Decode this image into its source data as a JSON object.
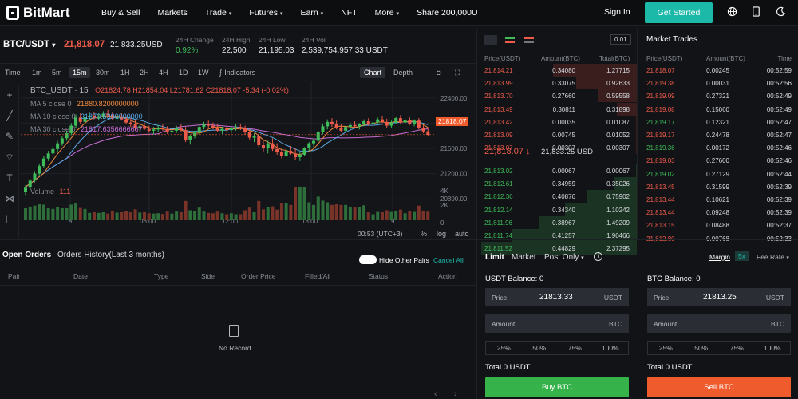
{
  "nav": {
    "brand": "BitMart",
    "menu": [
      "Buy & Sell",
      "Markets",
      "Trade",
      "Futures",
      "Earn",
      "NFT",
      "More",
      "Share 200,000U"
    ],
    "menu_caret": [
      false,
      false,
      true,
      true,
      true,
      false,
      true,
      false
    ],
    "sign_in": "Sign In",
    "get_started": "Get Started",
    "icons": [
      "globe-icon",
      "download-icon",
      "moon-icon"
    ]
  },
  "ticker": {
    "pair": "BTC/USDT",
    "last_price": "21,818.07",
    "usd_price": "21,833.25USD",
    "stats": [
      {
        "label": "24H Change",
        "value": "0.92%",
        "color": "#3fbd5a"
      },
      {
        "label": "24H High",
        "value": "22,500",
        "color": "#e8eaed"
      },
      {
        "label": "24H Low",
        "value": "21,195.03",
        "color": "#e8eaed"
      },
      {
        "label": "24H Vol",
        "value": "2,539,754,957.33 USDT",
        "color": "#e8eaed"
      }
    ]
  },
  "chart": {
    "timeframes": [
      "Time",
      "1m",
      "5m",
      "15m",
      "30m",
      "1H",
      "2H",
      "4H",
      "1D",
      "1W"
    ],
    "selected_timeframe": "15m",
    "indicators": "Indicators",
    "views": [
      "Chart",
      "Depth"
    ],
    "symbol_line": "BTC_USDT · 15",
    "ohlc": {
      "o": "21824.78",
      "h": "21854.04",
      "l": "21781.62",
      "c": "21818.07",
      "chg": "-5.34 (-0.02%)"
    },
    "ma": [
      {
        "label": "MA 5 close 0",
        "value": "21880.8200000000",
        "color": "#ef8a3c"
      },
      {
        "label": "MA 10 close 0",
        "value": "21870.5390000000",
        "color": "#5aa9e6"
      },
      {
        "label": "MA 30 close 0",
        "value": "21817.6356666667",
        "color": "#c86dd7"
      }
    ],
    "volume_label": "Volume",
    "volume_value": "111",
    "price_ticks": [
      "22400.00",
      "22000.00",
      "21600.00",
      "21200.00",
      "20800.00"
    ],
    "current_price_tag": "21818.07",
    "volume_ticks": [
      "4K",
      "2K",
      "0"
    ],
    "time_ticks": [
      "8",
      "06:00",
      "12:00",
      "18:00",
      "9"
    ],
    "clock": "00:53 (UTC+3)",
    "bottom_opts": [
      "%",
      "log",
      "auto"
    ],
    "colors": {
      "up": "#3fbd5a",
      "down": "#ef5b4b"
    }
  },
  "chart_data": {
    "type": "candlestick",
    "ylim": [
      20600,
      22600
    ],
    "candles": [
      [
        20910,
        21020,
        20860,
        20990
      ],
      [
        20990,
        21120,
        20950,
        21090
      ],
      [
        21090,
        21240,
        21060,
        21200
      ],
      [
        21200,
        21360,
        21160,
        21320
      ],
      [
        21320,
        21480,
        21290,
        21440
      ],
      [
        21440,
        21560,
        21400,
        21520
      ],
      [
        21520,
        21640,
        21480,
        21590
      ],
      [
        21590,
        21720,
        21550,
        21680
      ],
      [
        21680,
        21800,
        21640,
        21760
      ],
      [
        21760,
        21880,
        21720,
        21840
      ],
      [
        21840,
        22000,
        21810,
        21960
      ],
      [
        21960,
        22140,
        21920,
        22090
      ],
      [
        22090,
        22170,
        21980,
        22020
      ],
      [
        22020,
        22130,
        21990,
        22100
      ],
      [
        22100,
        22180,
        22040,
        22120
      ],
      [
        22120,
        22180,
        22060,
        22080
      ],
      [
        22080,
        22160,
        22040,
        22110
      ],
      [
        22110,
        22190,
        22070,
        22150
      ],
      [
        22150,
        22210,
        22090,
        22130
      ],
      [
        22130,
        22180,
        22050,
        22070
      ],
      [
        22070,
        22140,
        22010,
        22100
      ],
      [
        22100,
        22160,
        22040,
        22060
      ],
      [
        22060,
        22110,
        21980,
        22010
      ],
      [
        22010,
        22080,
        21940,
        21980
      ],
      [
        21980,
        22050,
        21880,
        21920
      ],
      [
        21920,
        21990,
        21860,
        21950
      ],
      [
        21950,
        22010,
        21890,
        21910
      ],
      [
        21910,
        21960,
        21850,
        21880
      ],
      [
        21880,
        21940,
        21820,
        21900
      ],
      [
        21900,
        21970,
        21860,
        21930
      ],
      [
        21930,
        21990,
        21880,
        21910
      ],
      [
        21910,
        21950,
        21830,
        21860
      ],
      [
        21860,
        21920,
        21800,
        21880
      ],
      [
        21880,
        21960,
        21840,
        21930
      ],
      [
        21930,
        21980,
        21860,
        21890
      ],
      [
        21890,
        21940,
        21700,
        21740
      ],
      [
        21740,
        21820,
        21660,
        21790
      ],
      [
        21790,
        21880,
        21760,
        21850
      ],
      [
        21850,
        21980,
        21820,
        21940
      ],
      [
        21940,
        22020,
        21900,
        21990
      ],
      [
        21990,
        22040,
        21920,
        21960
      ],
      [
        21960,
        22010,
        21900,
        21930
      ],
      [
        21930,
        21980,
        21860,
        21880
      ],
      [
        21880,
        21940,
        21830,
        21910
      ],
      [
        21910,
        21960,
        21860,
        21890
      ],
      [
        21890,
        21950,
        21840,
        21920
      ],
      [
        21920,
        21980,
        21880,
        21940
      ],
      [
        21940,
        21990,
        21890,
        21920
      ],
      [
        21920,
        21960,
        21820,
        21860
      ],
      [
        21860,
        21900,
        21740,
        21770
      ],
      [
        21770,
        21840,
        21700,
        21800
      ],
      [
        21800,
        21860,
        21620,
        21650
      ],
      [
        21650,
        21740,
        21550,
        21600
      ],
      [
        21600,
        21720,
        21520,
        21680
      ],
      [
        21680,
        21760,
        21560,
        21590
      ],
      [
        21590,
        21680,
        21500,
        21540
      ],
      [
        21540,
        21600,
        21440,
        21480
      ],
      [
        21480,
        21580,
        21460,
        21560
      ],
      [
        21560,
        21640,
        21500,
        21520
      ],
      [
        21520,
        21600,
        21420,
        21460
      ],
      [
        21460,
        21540,
        21400,
        21500
      ],
      [
        21500,
        21620,
        21480,
        21600
      ],
      [
        21600,
        21700,
        21560,
        21680
      ],
      [
        21680,
        21760,
        21620,
        21720
      ],
      [
        21720,
        21880,
        21690,
        21860
      ],
      [
        21860,
        21990,
        21820,
        21950
      ],
      [
        21950,
        22060,
        21900,
        22020
      ],
      [
        22020,
        22080,
        21940,
        21980
      ],
      [
        21980,
        22040,
        21900,
        21930
      ],
      [
        21930,
        21980,
        21860,
        21880
      ],
      [
        21880,
        21960,
        21860,
        21940
      ],
      [
        21940,
        22010,
        21900,
        21970
      ],
      [
        21970,
        22030,
        21920,
        21950
      ],
      [
        21950,
        22000,
        21900,
        21980
      ],
      [
        21980,
        22060,
        21950,
        22030
      ],
      [
        22030,
        22080,
        21960,
        21990
      ],
      [
        21990,
        22040,
        21940,
        22010
      ],
      [
        22010,
        22090,
        21980,
        22060
      ],
      [
        22060,
        22120,
        22000,
        22020
      ],
      [
        22020,
        22070,
        21930,
        21960
      ],
      [
        21960,
        22040,
        21930,
        22010
      ],
      [
        22010,
        22100,
        21990,
        22080
      ],
      [
        22080,
        22130,
        21990,
        22010
      ],
      [
        22010,
        22070,
        21980,
        22050
      ],
      [
        22050,
        22090,
        21970,
        21990
      ],
      [
        21990,
        22060,
        21950,
        22040
      ],
      [
        22040,
        22080,
        21900,
        21930
      ],
      [
        21930,
        21970,
        21840,
        21870
      ],
      [
        21870,
        21910,
        21790,
        21820
      ]
    ]
  },
  "orderbook": {
    "precision": "0.01",
    "headers": [
      "Price(USDT)",
      "Amount(BTC)",
      "Total(BTC)"
    ],
    "asks": [
      [
        "21,814.21",
        "0.34080",
        "1.27715"
      ],
      [
        "21,813.99",
        "0.33075",
        "0.92633"
      ],
      [
        "21,813.70",
        "0.27660",
        "0.59558"
      ],
      [
        "21,813.49",
        "0.30811",
        "0.31898"
      ],
      [
        "21,813.42",
        "0.00035",
        "0.01087"
      ],
      [
        "21,813.09",
        "0.00745",
        "0.01052"
      ],
      [
        "21,813.07",
        "0.00307",
        "0.00307"
      ]
    ],
    "mid_price": "21,818.07",
    "mid_usd": "21,833.25 USD",
    "bids": [
      [
        "21,813.02",
        "0.00067",
        "0.00067"
      ],
      [
        "21,812.61",
        "0.34959",
        "0.35026"
      ],
      [
        "21,812.36",
        "0.40876",
        "0.75902"
      ],
      [
        "21,812.14",
        "0.34340",
        "1.10242"
      ],
      [
        "21,811.96",
        "0.38967",
        "1.49209"
      ],
      [
        "21,811.74",
        "0.41257",
        "1.90466"
      ],
      [
        "21,811.52",
        "0.44829",
        "2.37295"
      ]
    ],
    "ask_depth": [
      0.54,
      0.39,
      0.25,
      0.13,
      0.005,
      0.005,
      0.001
    ],
    "bid_depth": [
      0.001,
      0.15,
      0.32,
      0.46,
      0.63,
      0.8,
      1.0
    ]
  },
  "market_trades": {
    "title": "Market Trades",
    "headers": [
      "Price(USDT)",
      "Amount(BTC)",
      "Time"
    ],
    "rows": [
      [
        "21,818.07",
        "0.00245",
        "00:52:59",
        "down"
      ],
      [
        "21,819.38",
        "0.00031",
        "00:52:56",
        "down"
      ],
      [
        "21,819.09",
        "0.27321",
        "00:52:49",
        "down"
      ],
      [
        "21,819.08",
        "0.15060",
        "00:52:49",
        "down"
      ],
      [
        "21,819.17",
        "0.12321",
        "00:52:47",
        "up"
      ],
      [
        "21,819.17",
        "0.24478",
        "00:52:47",
        "down"
      ],
      [
        "21,819.36",
        "0.00172",
        "00:52:46",
        "up"
      ],
      [
        "21,819.03",
        "0.27600",
        "00:52:46",
        "down"
      ],
      [
        "21,819.02",
        "0.27129",
        "00:52:44",
        "up"
      ],
      [
        "21,813.45",
        "0.31599",
        "00:52:39",
        "down"
      ],
      [
        "21,813.44",
        "0.10621",
        "00:52:39",
        "down"
      ],
      [
        "21,813.44",
        "0.09248",
        "00:52:39",
        "down"
      ],
      [
        "21,813.15",
        "0.08488",
        "00:52:37",
        "down"
      ],
      [
        "21,812.80",
        "0.00768",
        "00:52:33",
        "down"
      ]
    ]
  },
  "orders": {
    "tabs": [
      "Open Orders",
      "Orders History(Last 3 months)"
    ],
    "hide_other_pairs": "Hide Other Pairs",
    "cancel_all": "Cancel All",
    "columns": [
      "Pair",
      "Date",
      "Type",
      "Side",
      "Order Price",
      "Filled/All",
      "Status",
      "Action"
    ],
    "empty": "No Record",
    "pager": [
      "‹",
      "›"
    ]
  },
  "trade": {
    "order_types": [
      "Limit",
      "Market",
      "Post Only"
    ],
    "margin": "Margin",
    "leverage": "5x",
    "fee_rate": "Fee Rate",
    "buy": {
      "balance": "USDT Balance: 0",
      "price_label": "Price",
      "price_value": "21813.33",
      "price_unit": "USDT",
      "amount_placeholder": "Amount",
      "amount_unit": "BTC",
      "total": "Total 0 USDT",
      "button": "Buy BTC"
    },
    "sell": {
      "balance": "BTC Balance: 0",
      "price_label": "Price",
      "price_value": "21813.25",
      "price_unit": "USDT",
      "amount_placeholder": "Amount",
      "amount_unit": "BTC",
      "total": "Total 0 USDT",
      "button": "Sell BTC"
    },
    "percentages": [
      "25%",
      "50%",
      "75%",
      "100%"
    ],
    "colors": {
      "buy": "#36b24a",
      "sell": "#ef5b2c"
    }
  }
}
